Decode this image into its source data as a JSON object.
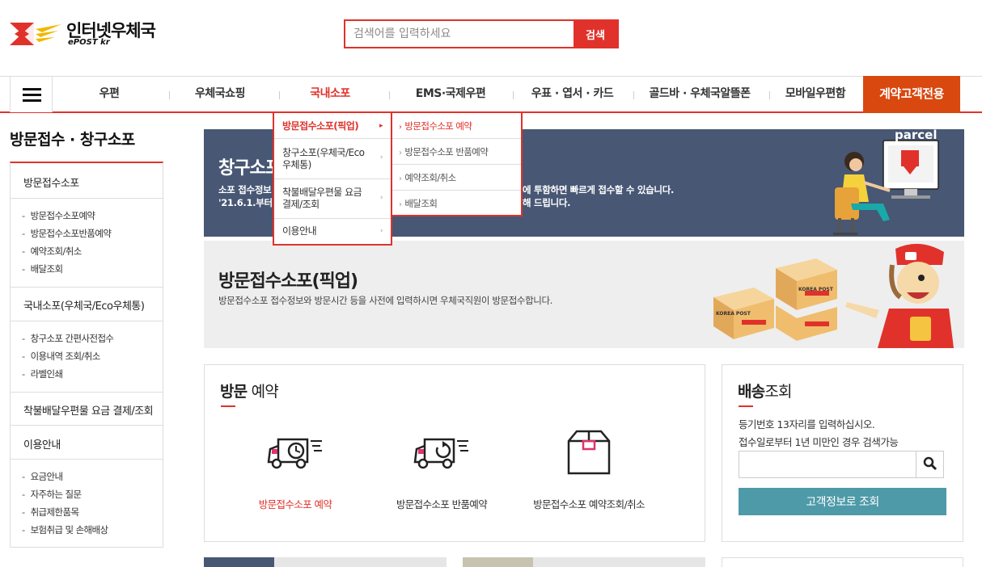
{
  "header": {
    "logo_title": "인터넷우체국",
    "logo_sub": "ePOST kr",
    "search_placeholder": "검색어를 입력하세요",
    "search_button": "검색"
  },
  "gnb": {
    "items": [
      "우편",
      "우체국쇼핑",
      "국내소포",
      "EMS·국제우편",
      "우표 · 엽서 · 카드",
      "골드바 · 우체국알뜰폰",
      "모바일우편함"
    ],
    "special": "계약고객전용",
    "active_index": 2
  },
  "dropdown": {
    "level1": [
      "방문접수소포(픽업)",
      "창구소포(우체국/Eco우체통)",
      "착불배달우편물 요금 결제/조회",
      "이용안내"
    ],
    "level2": [
      "방문접수소포 예약",
      "방문접수소포 반품예약",
      "예약조회/취소",
      "배달조회"
    ]
  },
  "sidebar": {
    "title": "방문접수 · 창구소포",
    "categories": [
      {
        "label": "방문접수소포",
        "items": [
          "방문접수소포예약",
          "방문접수소포반품예약",
          "예약조회/취소",
          "배달조회"
        ]
      },
      {
        "label": "국내소포(우체국/Eco우체통)",
        "items": [
          "창구소포 간편사전접수",
          "이용내역 조회/취소",
          "라벨인쇄"
        ]
      },
      {
        "label": "착불배달우편물 요금 결제/조회",
        "items": []
      },
      {
        "label": "이용안내",
        "items": [
          "요금안내",
          "자주하는 질문",
          "취급제한품목",
          "보험취급 및 손해배상"
        ]
      }
    ]
  },
  "banner1": {
    "title": "창구소포",
    "desc1": "소포 접수정보",
    "desc2": "'21.6.1.부터",
    "desc3": "에 투함하면 빠르게 접수할 수 있습니다.",
    "desc4": "해 드립니다.",
    "illustration_label": "parcel"
  },
  "banner2": {
    "title": "방문접수소포(픽업)",
    "desc": "방문접수소포 접수정보와 방문시간 등을 사전에 입력하시면 우체국직원이 방문접수합니다.",
    "box_label": "KOREA POST"
  },
  "visit": {
    "title_bold": "방문",
    "title_rest": " 예약",
    "items": [
      "방문접수소포 예약",
      "방문접수소포 반품예약",
      "방문접수소포 예약조회/취소"
    ]
  },
  "delivery": {
    "title_bold": "배송",
    "title_rest": "조회",
    "line1": "등기번호 13자리를 입력하십시오.",
    "line2": "접수일로부터 1년 미만인 경우 검색가능",
    "button": "고객정보로 조회"
  },
  "colors": {
    "accent": "#e0322b",
    "special": "#d9480f",
    "banner1_bg": "#475774",
    "teal_button": "#4e9aa8"
  }
}
